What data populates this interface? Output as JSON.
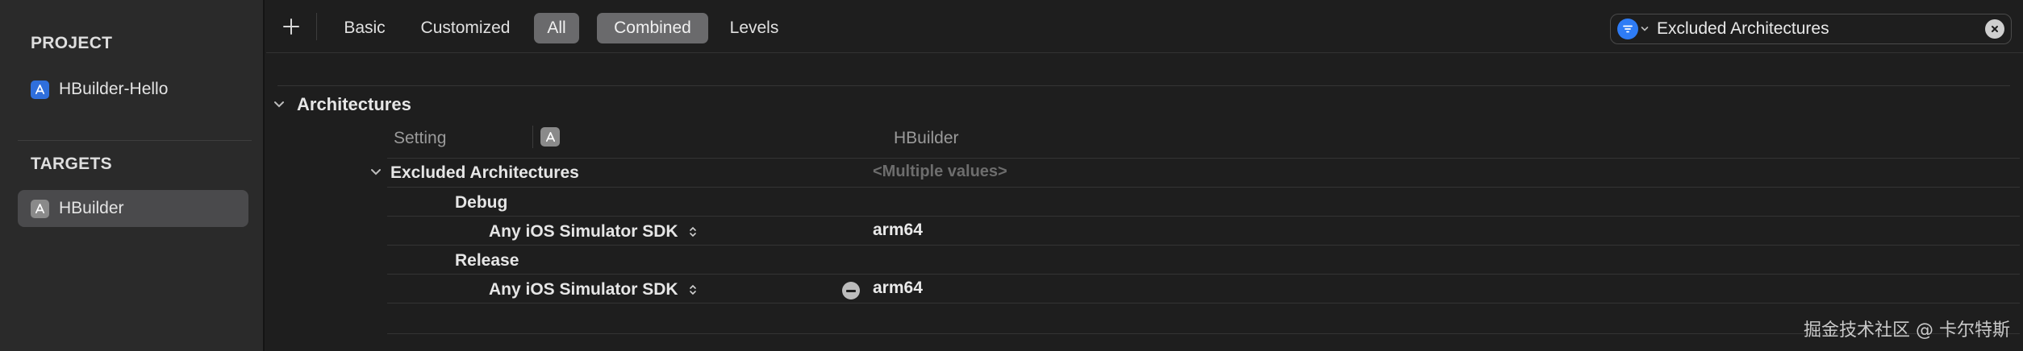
{
  "sidebar": {
    "project_title": "PROJECT",
    "project_item": "HBuilder-Hello",
    "targets_title": "TARGETS",
    "target_item": "HBuilder"
  },
  "toolbar": {
    "segments": {
      "basic": "Basic",
      "customized": "Customized",
      "all": "All",
      "combined": "Combined",
      "levels": "Levels"
    },
    "search_value": "Excluded Architectures"
  },
  "settings": {
    "group_title": "Architectures",
    "header_setting": "Setting",
    "header_target": "HBuilder",
    "excluded_title": "Excluded Architectures",
    "excluded_value": "<Multiple values>",
    "debug_label": "Debug",
    "release_label": "Release",
    "sdk_label": "Any iOS Simulator SDK",
    "debug_value": "arm64",
    "release_value": "arm64"
  },
  "watermark": "掘金技术社区 @ 卡尔特斯",
  "colors": {
    "accent": "#2e7cf6",
    "selected_segment": "#6a6a6c",
    "sidebar_selected": "#4a4a4c"
  },
  "icons": [
    "app-target-icon",
    "plus-icon",
    "filter-icon",
    "chevron-down-icon",
    "clear-icon",
    "up-down-icon",
    "remove-icon"
  ]
}
